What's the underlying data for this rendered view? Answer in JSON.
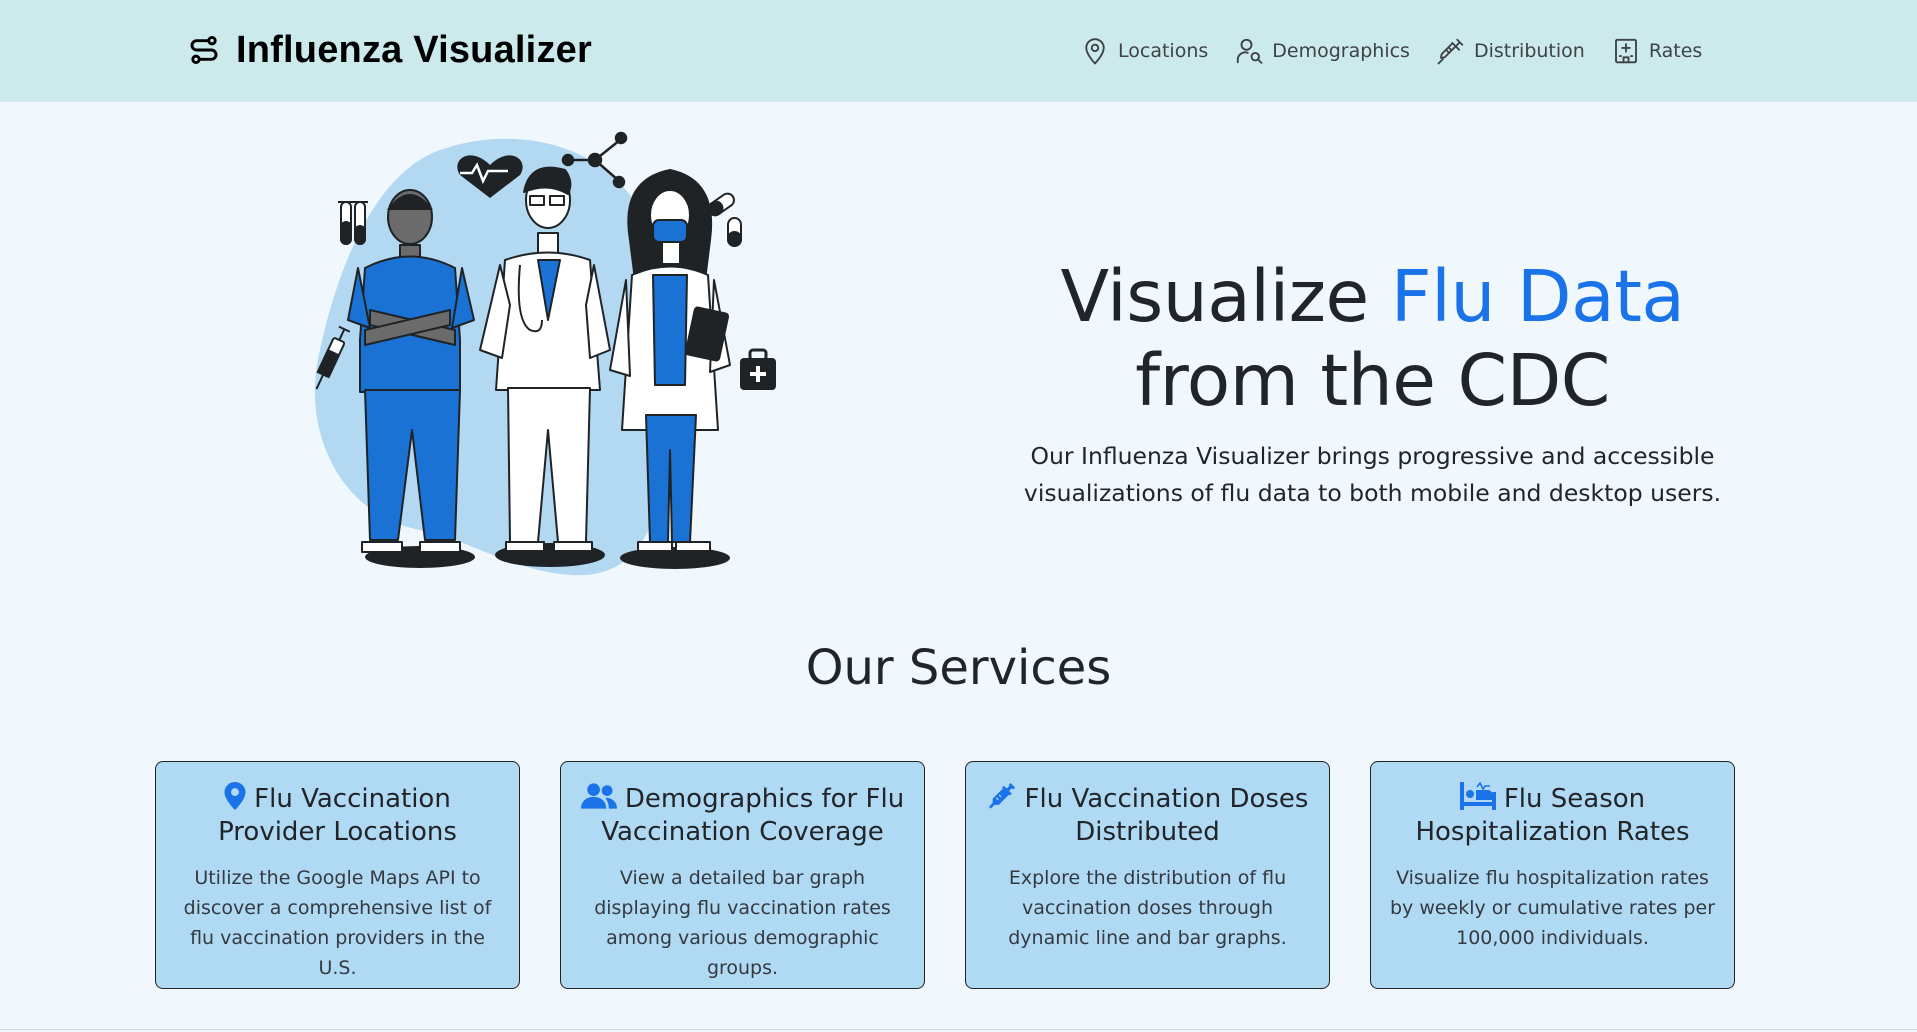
{
  "brand": {
    "name": "Influenza Visualizer",
    "logo_icon": "route-icon"
  },
  "nav": {
    "items": [
      {
        "label": "Locations",
        "icon": "map-pin-icon"
      },
      {
        "label": "Demographics",
        "icon": "user-search-icon"
      },
      {
        "label": "Distribution",
        "icon": "syringe-icon"
      },
      {
        "label": "Rates",
        "icon": "hospital-icon"
      }
    ]
  },
  "hero": {
    "title_part1": "Visualize ",
    "title_accent": "Flu Data",
    "title_part2": "from the CDC",
    "subtitle": "Our Influenza Visualizer brings progressive and accessible visualizations of flu data to both mobile and desktop users.",
    "illustration": "doctors-illustration"
  },
  "services": {
    "heading": "Our Services",
    "cards": [
      {
        "icon": "map-marker-icon",
        "title": "Flu Vaccination Provider Locations",
        "description": "Utilize the Google Maps API to discover a comprehensive list of flu vaccination providers in the U.S."
      },
      {
        "icon": "users-icon",
        "title": "Demographics for Flu Vaccination Coverage",
        "description": "View a detailed bar graph displaying flu vaccination rates among various demographic groups."
      },
      {
        "icon": "syringe-icon",
        "title": "Flu Vaccination Doses Distributed",
        "description": "Explore the distribution of flu vaccination doses through dynamic line and bar graphs."
      },
      {
        "icon": "hospital-bed-icon",
        "title": "Flu Season Hospitalization Rates",
        "description": "Visualize flu hospitalization rates by weekly or cumulative rates per 100,000 individuals."
      }
    ]
  },
  "colors": {
    "navbar_bg": "#cceaec",
    "page_bg": "#f0f7fd",
    "accent": "#1a73e8",
    "card_bg": "#b0d9f4",
    "illustration_blob": "#b3d9f2",
    "scrub_blue": "#1a73d4"
  }
}
